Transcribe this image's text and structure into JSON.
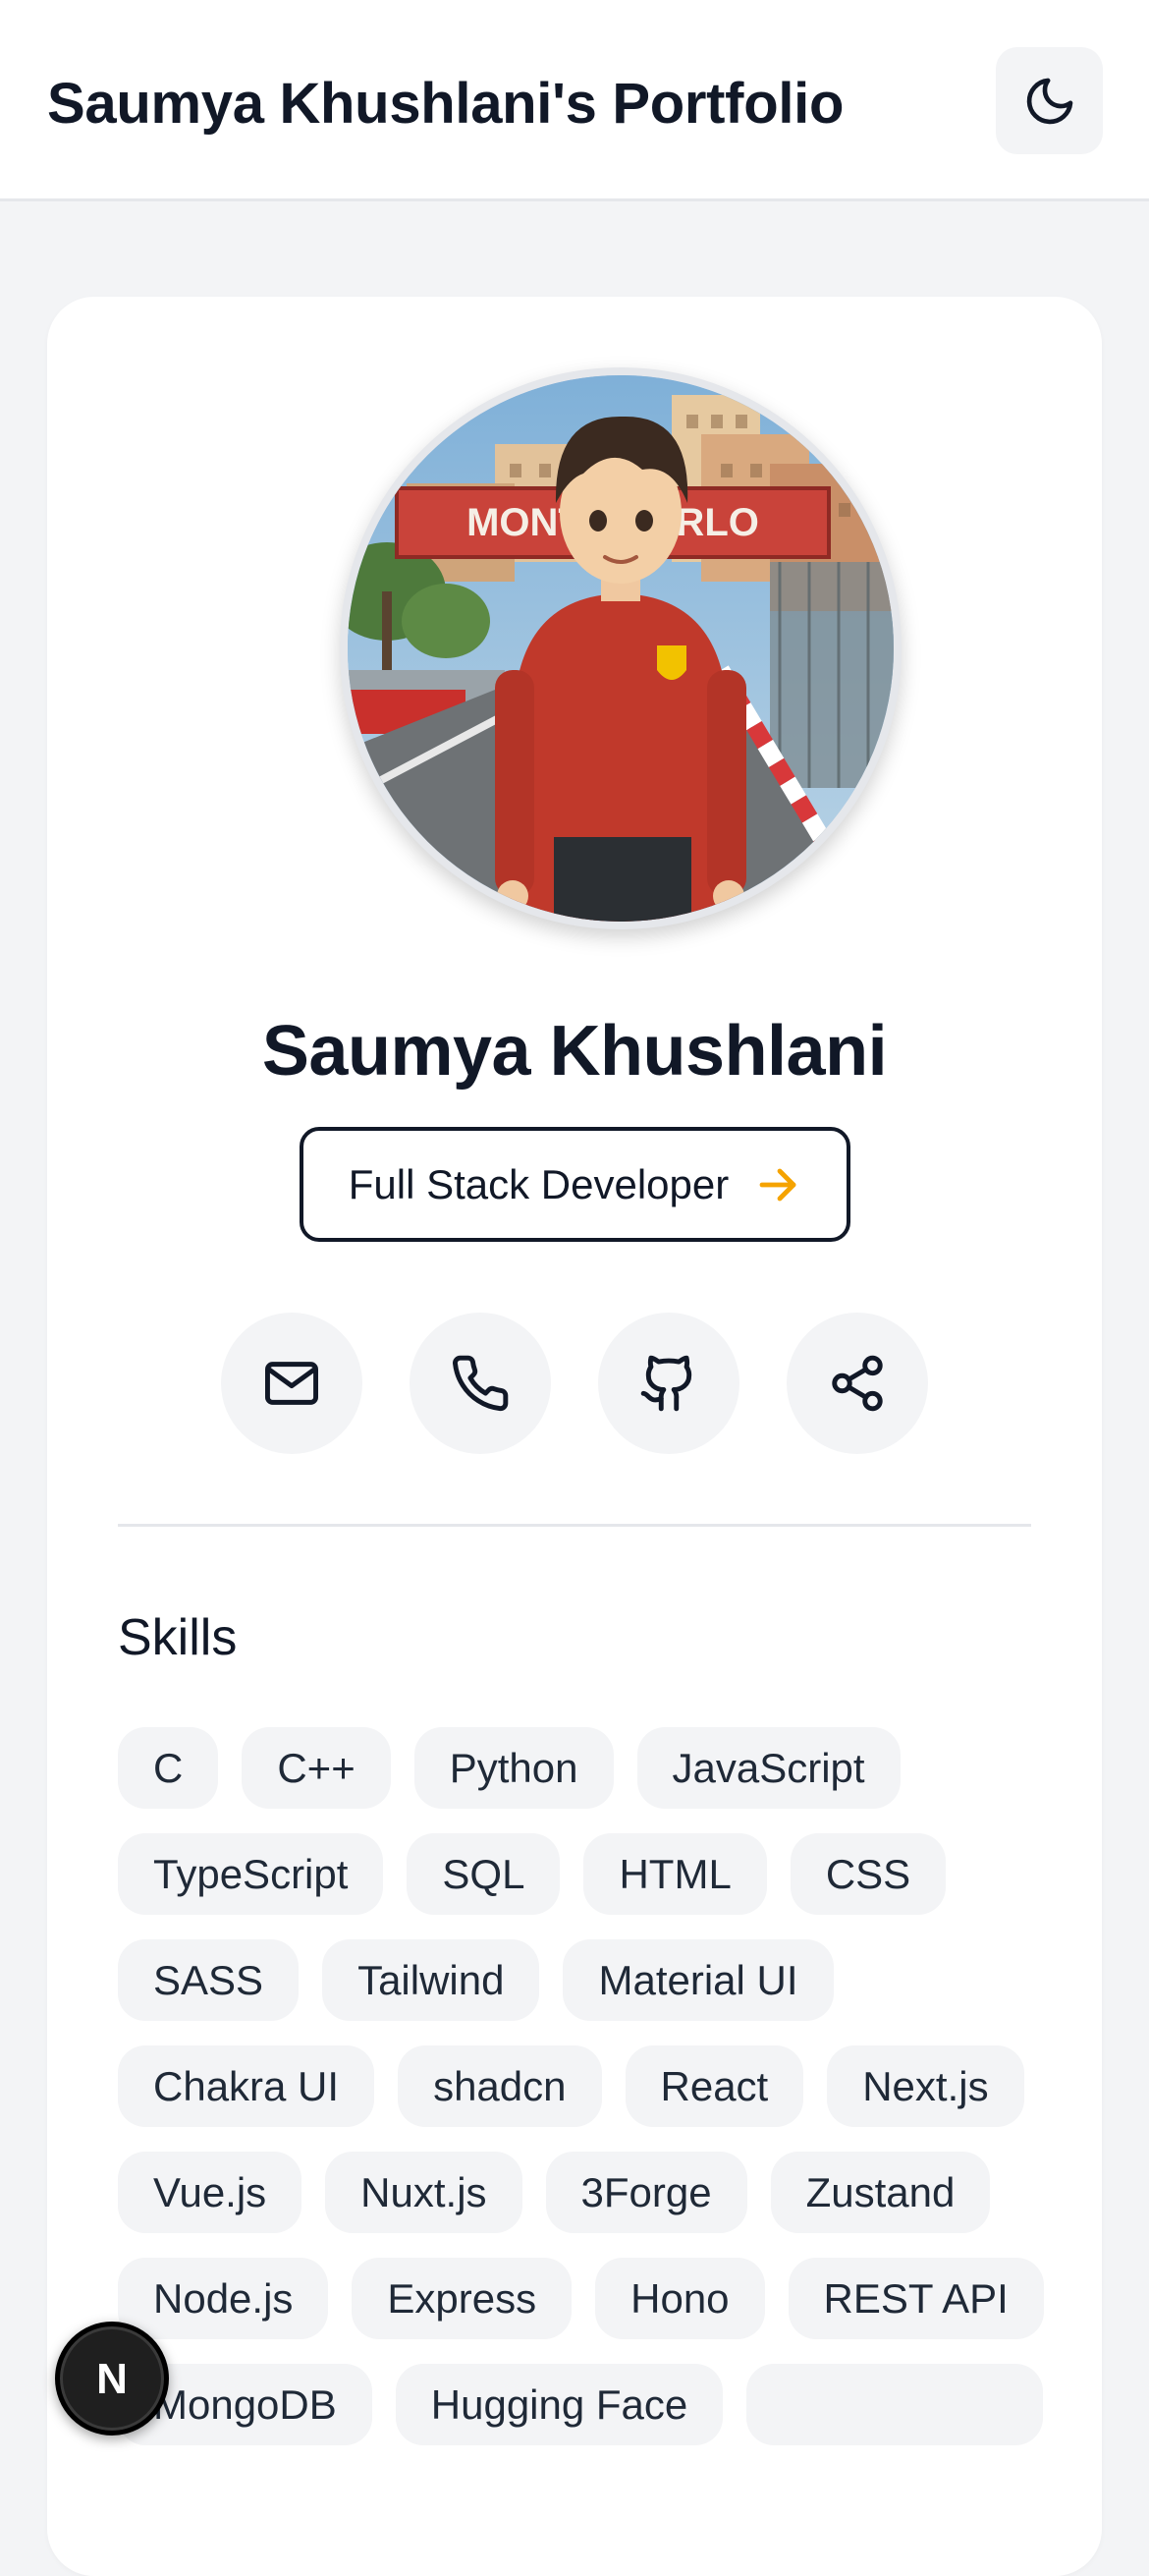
{
  "header": {
    "title": "Saumya Khushlani's Portfolio",
    "theme_toggle_icon": "moon-icon"
  },
  "profile": {
    "avatar_sign": "MONTE CARLO",
    "name": "Saumya Khushlani",
    "role": "Full Stack Developer",
    "role_icon": "arrow-right-icon",
    "accent_color": "#f5a300"
  },
  "contacts": [
    {
      "icon": "mail-icon"
    },
    {
      "icon": "phone-icon"
    },
    {
      "icon": "github-icon"
    },
    {
      "icon": "share-icon"
    }
  ],
  "skills": {
    "title": "Skills",
    "items": [
      "C",
      "C++",
      "Python",
      "JavaScript",
      "TypeScript",
      "SQL",
      "HTML",
      "CSS",
      "SASS",
      "Tailwind",
      "Material UI",
      "Chakra UI",
      "shadcn",
      "React",
      "Next.js",
      "Vue.js",
      "Nuxt.js",
      "3Forge",
      "Zustand",
      "Node.js",
      "Express",
      "Hono",
      "REST API",
      "MongoDB",
      "Hugging Face"
    ]
  },
  "dev_badge": {
    "letter": "N",
    "icon": "nextjs-icon"
  }
}
